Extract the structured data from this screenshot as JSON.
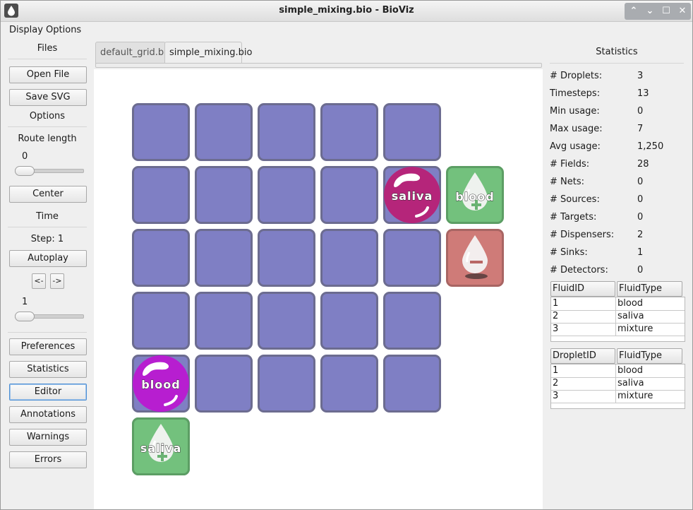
{
  "window": {
    "title": "simple_mixing.bio - BioViz",
    "app_icon": "droplet-icon"
  },
  "window_buttons": [
    "up-icon",
    "down-icon",
    "maximize-icon",
    "close-icon"
  ],
  "window_button_glyphs": [
    "⌃",
    "⌄",
    "☐",
    "✕"
  ],
  "menu": {
    "display_options": "Display Options"
  },
  "sidebar": {
    "files_label": "Files",
    "open_file": "Open File",
    "save_svg": "Save SVG",
    "options_label": "Options",
    "route_length_label": "Route length",
    "route_length_value": "0",
    "route_length_fraction": 0.0,
    "center": "Center",
    "time_label": "Time",
    "step_text": "Step:  1",
    "autoplay": "Autoplay",
    "prev": "<-",
    "next": "->",
    "speed_value": "1",
    "speed_fraction": 0.0,
    "preferences": "Preferences",
    "statistics": "Statistics",
    "editor": "Editor",
    "annotations": "Annotations",
    "warnings": "Warnings",
    "errors": "Errors"
  },
  "tabs": [
    {
      "label": "default_grid.bio",
      "active": false
    },
    {
      "label": "simple_mixing.bio",
      "active": true
    }
  ],
  "grid": {
    "cells": [
      [
        0,
        0
      ],
      [
        1,
        0
      ],
      [
        2,
        0
      ],
      [
        3,
        0
      ],
      [
        4,
        0
      ],
      [
        0,
        1
      ],
      [
        1,
        1
      ],
      [
        2,
        1
      ],
      [
        3,
        1
      ],
      [
        4,
        1
      ],
      [
        0,
        2
      ],
      [
        1,
        2
      ],
      [
        2,
        2
      ],
      [
        3,
        2
      ],
      [
        4,
        2
      ],
      [
        0,
        3
      ],
      [
        1,
        3
      ],
      [
        2,
        3
      ],
      [
        3,
        3
      ],
      [
        4,
        3
      ],
      [
        0,
        4
      ],
      [
        1,
        4
      ],
      [
        2,
        4
      ],
      [
        3,
        4
      ],
      [
        4,
        4
      ],
      [
        0,
        5
      ]
    ],
    "dispensers": [
      {
        "col": 5,
        "row": 1,
        "label": "blood",
        "icon": "droplet-plus-icon"
      },
      {
        "col": 0,
        "row": 5,
        "label": "saliva",
        "icon": "droplet-plus-icon"
      }
    ],
    "sinks": [
      {
        "col": 5,
        "row": 2,
        "icon": "droplet-minus-icon"
      }
    ],
    "droplets": [
      {
        "col": 4,
        "row": 1,
        "label": "saliva",
        "color": "#b5257a"
      },
      {
        "col": 0,
        "row": 4,
        "label": "blood",
        "color": "#b71ed0"
      }
    ],
    "colors": {
      "cell": "#7f7fc4",
      "dispenser": "#73c17d",
      "sink": "#cf7b78"
    }
  },
  "statistics": {
    "title": "Statistics",
    "rows": [
      {
        "key": "# Droplets:",
        "value": "3"
      },
      {
        "key": "Timesteps:",
        "value": "13"
      },
      {
        "key": "Min usage:",
        "value": "0"
      },
      {
        "key": "Max usage:",
        "value": "7"
      },
      {
        "key": "Avg usage:",
        "value": "1,250"
      },
      {
        "key": "# Fields:",
        "value": "28"
      },
      {
        "key": "# Nets:",
        "value": "0"
      },
      {
        "key": "# Sources:",
        "value": "0"
      },
      {
        "key": "# Targets:",
        "value": "0"
      },
      {
        "key": "# Dispensers:",
        "value": "2"
      },
      {
        "key": "# Sinks:",
        "value": "1"
      },
      {
        "key": "# Detectors:",
        "value": "0"
      }
    ],
    "fluid_table": {
      "headers": [
        "FluidID",
        "FluidType"
      ],
      "rows": [
        [
          "1",
          "blood"
        ],
        [
          "2",
          "saliva"
        ],
        [
          "3",
          "mixture"
        ]
      ]
    },
    "droplet_table": {
      "headers": [
        "DropletID",
        "FluidType"
      ],
      "rows": [
        [
          "1",
          "blood"
        ],
        [
          "2",
          "saliva"
        ],
        [
          "3",
          "mixture"
        ]
      ]
    }
  }
}
